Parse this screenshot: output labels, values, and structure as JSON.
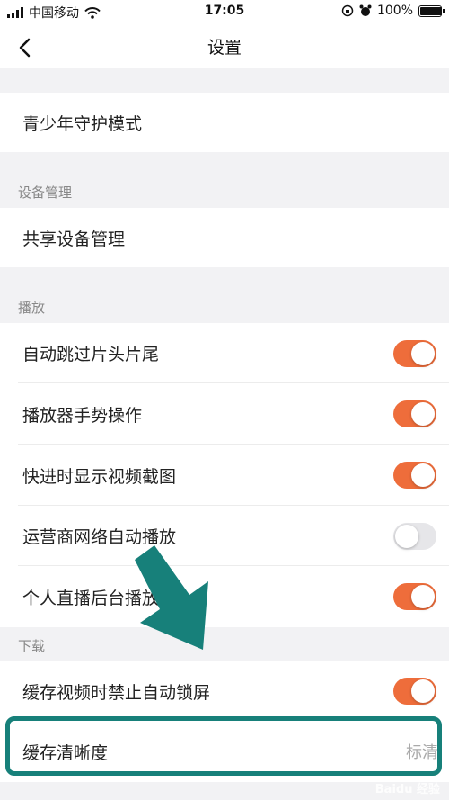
{
  "status": {
    "carrier": "中国移动",
    "time": "17:05",
    "battery_text": "100%",
    "battery_level": 1.0
  },
  "nav": {
    "title": "设置"
  },
  "rows": {
    "youth": "青少年守护模式",
    "shared_devices": "共享设备管理",
    "auto_skip": "自动跳过片头片尾",
    "gesture": "播放器手势操作",
    "preview": "快进时显示视频截图",
    "carrier_autoplay": "运营商网络自动播放",
    "background_live": "个人直播后台播放",
    "no_lock": "缓存视频时禁止自动锁屏",
    "cache_quality": "缓存清晰度",
    "cache_quality_value": "标清"
  },
  "sections": {
    "device": "设备管理",
    "playback": "播放",
    "download": "下载"
  },
  "toggles": {
    "auto_skip": true,
    "gesture": true,
    "preview": true,
    "carrier_autoplay": false,
    "background_live": true,
    "no_lock": true
  },
  "colors": {
    "accent": "#ee6d3b",
    "annotation": "#17807a"
  },
  "icons": {
    "back": "chevron-left-icon",
    "wifi": "wifi-icon",
    "alarm": "alarm-icon",
    "lock": "orientation-lock-icon"
  },
  "watermark": "Baidu 经验"
}
